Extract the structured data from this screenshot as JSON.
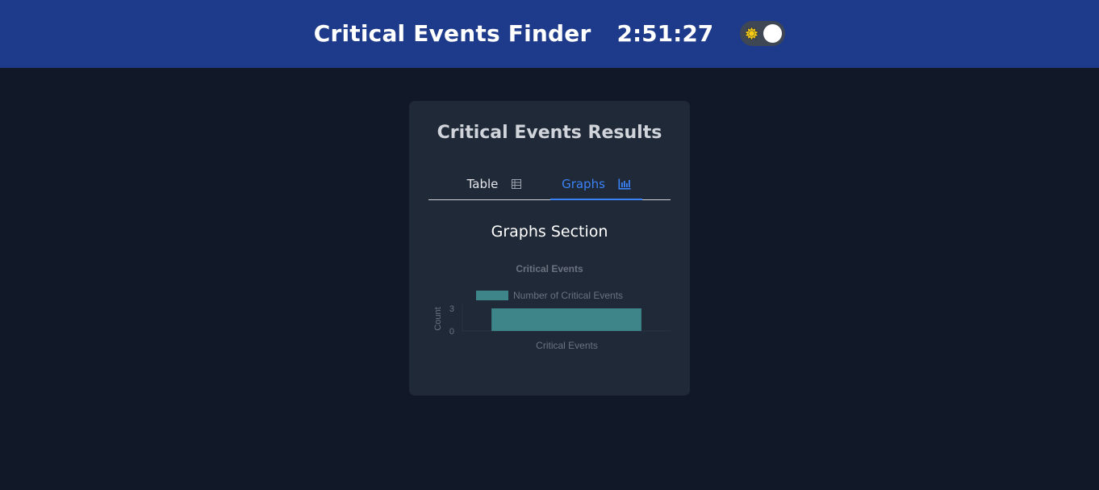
{
  "header": {
    "title": "Critical Events Finder",
    "time": "2:51:27"
  },
  "theme_toggle": {
    "icon": "sun-icon",
    "state": "on"
  },
  "card": {
    "title": "Critical Events Results",
    "tabs": [
      {
        "label": "Table",
        "icon": "table-icon",
        "active": false
      },
      {
        "label": "Graphs",
        "icon": "bar-chart-icon",
        "active": true
      }
    ],
    "section_title": "Graphs Section"
  },
  "chart_data": {
    "type": "bar",
    "title": "Critical Events",
    "categories": [
      "Critical Events"
    ],
    "series": [
      {
        "name": "Number of Critical Events",
        "values": [
          3
        ],
        "color": "#3d8588"
      }
    ],
    "xlabel": "Critical Events",
    "ylabel": "Count",
    "ylim": [
      0,
      3
    ],
    "yticks": [
      "3",
      "0"
    ],
    "legend": "top"
  },
  "colors": {
    "header_bg": "#1e3a8a",
    "page_bg": "#111827",
    "card_bg": "#1f2937",
    "accent": "#3b82f6"
  }
}
